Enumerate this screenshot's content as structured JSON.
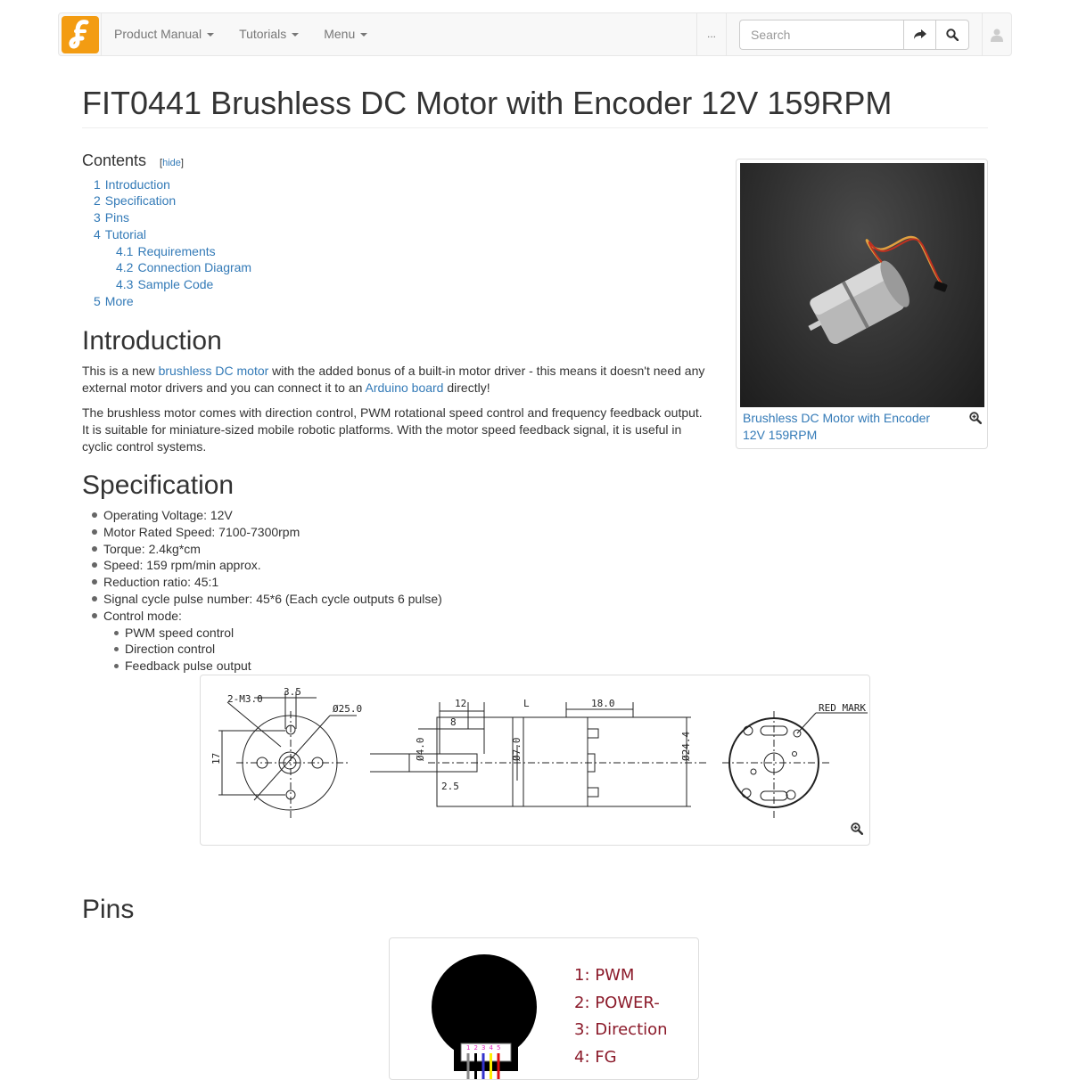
{
  "navbar": {
    "brand_letter": "f",
    "brand_color": "#f39c12",
    "menus": [
      {
        "label": "Product Manual"
      },
      {
        "label": "Tutorials"
      },
      {
        "label": "Menu"
      }
    ],
    "more_label": "...",
    "search_placeholder": "Search",
    "go_icon": "share-arrow-icon",
    "search_icon": "search-icon",
    "user_icon": "user-icon"
  },
  "page": {
    "title": "FIT0441 Brushless DC Motor with Encoder 12V 159RPM"
  },
  "toc": {
    "title": "Contents",
    "toggle_open": "[",
    "toggle_label": "hide",
    "toggle_close": "]",
    "items": [
      {
        "num": "1",
        "label": "Introduction",
        "level": 1
      },
      {
        "num": "2",
        "label": "Specification",
        "level": 1
      },
      {
        "num": "3",
        "label": "Pins",
        "level": 1
      },
      {
        "num": "4",
        "label": "Tutorial",
        "level": 1
      },
      {
        "num": "4.1",
        "label": "Requirements",
        "level": 2
      },
      {
        "num": "4.2",
        "label": "Connection Diagram",
        "level": 2
      },
      {
        "num": "4.3",
        "label": "Sample Code",
        "level": 2
      },
      {
        "num": "5",
        "label": "More",
        "level": 1
      }
    ]
  },
  "thumbnail": {
    "caption": "Brushless DC Motor with Encoder 12V 159RPM",
    "enlarge_icon": "magnify-icon"
  },
  "introduction": {
    "heading": "Introduction",
    "p1_a": "This is a new ",
    "p1_link1": "brushless DC motor",
    "p1_b": " with the added bonus of a built-in motor driver - this means it doesn't need any external motor drivers and you can connect it to an ",
    "p1_link2": "Arduino board",
    "p1_c": " directly!",
    "p2": "The brushless motor comes with direction control, PWM rotational speed control and frequency feedback output. It is suitable for miniature-sized mobile robotic platforms. With the motor speed feedback signal, it is useful in cyclic control systems."
  },
  "specification": {
    "heading": "Specification",
    "items": [
      "Operating Voltage: 12V",
      "Motor Rated Speed: 7100-7300rpm",
      "Torque: 2.4kg*cm",
      "Speed: 159 rpm/min approx.",
      "Reduction ratio: 45:1",
      "Signal cycle pulse number: 45*6 (Each cycle outputs 6 pulse)",
      "Control mode:"
    ],
    "sub_items": [
      "PWM speed control",
      "Direction control",
      "Feedback pulse output"
    ],
    "drawing_labels": {
      "m3": "2-M3.0",
      "d35": "3.5",
      "d25": "Ø25.0",
      "d17": "17",
      "d12": "12",
      "d8": "8",
      "L": "L",
      "d18": "18.0",
      "d4": "Ø4.0",
      "d7": "Ø7.0",
      "d25b": "2.5",
      "d244": "Ø24.4",
      "red_mark": "RED MARK"
    }
  },
  "pins": {
    "heading": "Pins",
    "labels": [
      "1: PWM",
      "2: POWER-",
      "3: Direction",
      "4: FG"
    ],
    "connector_nums": [
      "1",
      "2",
      "3",
      "4",
      "5"
    ],
    "wire_colors": [
      "#888888",
      "#000000",
      "#3333cc",
      "#ffee00",
      "#dd1111"
    ]
  }
}
